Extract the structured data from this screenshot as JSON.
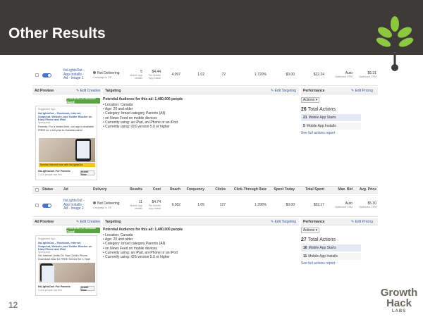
{
  "slide": {
    "title": "Other Results",
    "page_number": "12"
  },
  "brand": {
    "line1": "Growth",
    "line2": "Hack",
    "line3": "LABS"
  },
  "row1": {
    "ad_name": "ItsLightsOut - App Installs - Ad - Image 1",
    "delivery": "Not Delivering",
    "delivery_sub": "Campaign is Off",
    "results": "5",
    "results_sub": "Mobile App Installs",
    "cost": "$4.44",
    "cost_sub": "Per Mobile App Install",
    "reach": "4,097",
    "frequency": "1.02",
    "clicks": "72",
    "ctr": "1.720%",
    "spent_today": "$0.00",
    "total_spent": "$22.24",
    "max_bid": "Auto",
    "max_bid_sub": "Optimized CPM",
    "avg_price": "$5.31",
    "avg_price_sub": "Optimized CPM"
  },
  "columns": [
    "Status",
    "Ad",
    "Delivery",
    "Results",
    "Cost",
    "Reach",
    "Frequency",
    "Clicks",
    "Click-Through Rate",
    "Spent Today",
    "Total Spent",
    "Max. Bid",
    "Avg. Price"
  ],
  "row2": {
    "ad_name": "ItsLightsOut - App Installs - Ad - Image 2",
    "delivery": "Not Delivering",
    "delivery_sub": "Campaign is Off",
    "results": "11",
    "results_sub": "Mobile App Installs",
    "cost": "$4.74",
    "cost_sub": "Per Mobile App Install",
    "reach": "9,382",
    "frequency": "1.05",
    "clicks": "127",
    "ctr": "1.290%",
    "spent_today": "$0.00",
    "total_spent": "$52.17",
    "max_bid": "Auto",
    "max_bid_sub": "Optimized CPM",
    "avg_price": "$5.30",
    "avg_price_sub": "Optimized CPM"
  },
  "panel_labels": {
    "ad_preview": "Ad Preview",
    "edit_creative": "Edit Creative",
    "targeting": "Targeting",
    "edit_targeting": "Edit Targeting",
    "performance": "Performance",
    "edit_pricing": "Edit Pricing",
    "preview_button": "Preview in Mobile Feed",
    "actions_dropdown": "Actions",
    "see_full": "See full actions report",
    "total_actions_label": "Total Actions"
  },
  "panel1": {
    "ad_suggested": "Suggested App",
    "ad_headline": "ItsLightsOut – Facebook, Internet, Snapchat, Website, and Twitter Blocker on Kids iPhone and iPad",
    "ad_sponsored": "Sponsored",
    "ad_text": "Parents: For a limited time, our app is available FREE for a full year to Canada users!",
    "ad_banner": "Monitor internet time with ItsLightsOut",
    "ad_footer_name": "ItsLightsOut: For Parents",
    "ad_footer_sub": "2,116 people use this",
    "install_label": "Install Now",
    "targeting_title": "Potential Audience for this ad: 1,480,000 people",
    "targeting_items": [
      "Location: Canada",
      "Age: 20 and older",
      "Category: broad category Parents (All)",
      "on News Feed on mobile devices",
      "Currently using: an iPad, an iPhone or an iPod",
      "Currently using: iOS version 5.0 or higher"
    ],
    "total_actions": "26",
    "metrics": [
      {
        "count": "21",
        "label": "Mobile App Starts"
      },
      {
        "count": "5",
        "label": "Mobile App Installs"
      }
    ]
  },
  "panel2": {
    "ad_suggested": "Suggested App",
    "ad_headline": "ItsLightsOut – Facebook, Internet, Snapchat, Website, and Twitter Blocker on Kids iPhone and iPad",
    "ad_sponsored": "Sponsored",
    "ad_text": "Set Internet Limits On Your Child's Phone. Download Now for FREE Service for 1 Year!",
    "ad_footer_name": "ItsLightsOut: For Parents",
    "ad_footer_sub": "2,116 people use this",
    "install_label": "Install Now",
    "targeting_title": "Potential Audience for this ad: 1,480,000 people",
    "targeting_items": [
      "Location: Canada",
      "Age: 20 and older",
      "Category: broad category Parents (All)",
      "on News Feed on mobile devices",
      "Currently using: an iPad, an iPhone or an iPod",
      "Currently using: iOS version 5.0 or higher"
    ],
    "total_actions": "27",
    "metrics": [
      {
        "count": "16",
        "label": "Mobile App Starts"
      },
      {
        "count": "11",
        "label": "Mobile App Installs"
      }
    ]
  },
  "colors": {
    "header_bg": "#3d3a37",
    "accent_green": "#5ba443",
    "link_blue": "#3b5998",
    "leaf_green": "#8dc63f"
  }
}
